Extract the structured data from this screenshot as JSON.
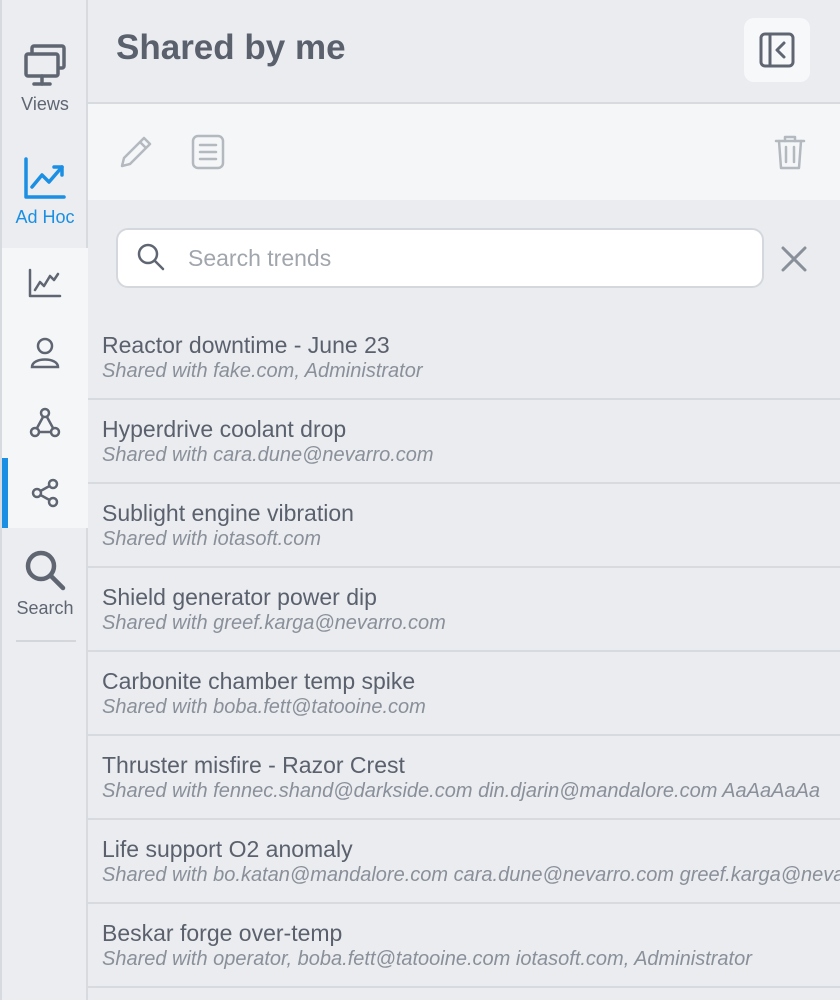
{
  "sidebar": {
    "views_label": "Views",
    "adhoc_label": "Ad Hoc",
    "search_label": "Search",
    "accent_color": "#1a8fe3",
    "subnav": [
      {
        "icon": "line-chart-icon"
      },
      {
        "icon": "user-icon"
      },
      {
        "icon": "network-icon"
      },
      {
        "icon": "share-icon"
      }
    ]
  },
  "header": {
    "title": "Shared by me"
  },
  "search": {
    "placeholder": "Search trends",
    "value": ""
  },
  "items": [
    {
      "title": "Reactor downtime - June 23",
      "shared": "Shared with fake.com, Administrator"
    },
    {
      "title": "Hyperdrive coolant drop",
      "shared": "Shared with cara.dune@nevarro.com"
    },
    {
      "title": "Sublight engine vibration",
      "shared": "Shared with iotasoft.com"
    },
    {
      "title": "Shield generator power dip",
      "shared": "Shared with greef.karga@nevarro.com"
    },
    {
      "title": "Carbonite chamber temp spike",
      "shared": "Shared with boba.fett@tatooine.com"
    },
    {
      "title": "Thruster misfire - Razor Crest",
      "shared": "Shared with fennec.shand@darkside.com din.djarin@mandalore.com AaAaAaAa"
    },
    {
      "title": "Life support O2 anomaly",
      "shared": "Shared with bo.katan@mandalore.com cara.dune@nevarro.com greef.karga@nevarro.com"
    },
    {
      "title": "Beskar forge over-temp",
      "shared": "Shared with operator, boba.fett@tatooine.com iotasoft.com, Administrator"
    }
  ]
}
